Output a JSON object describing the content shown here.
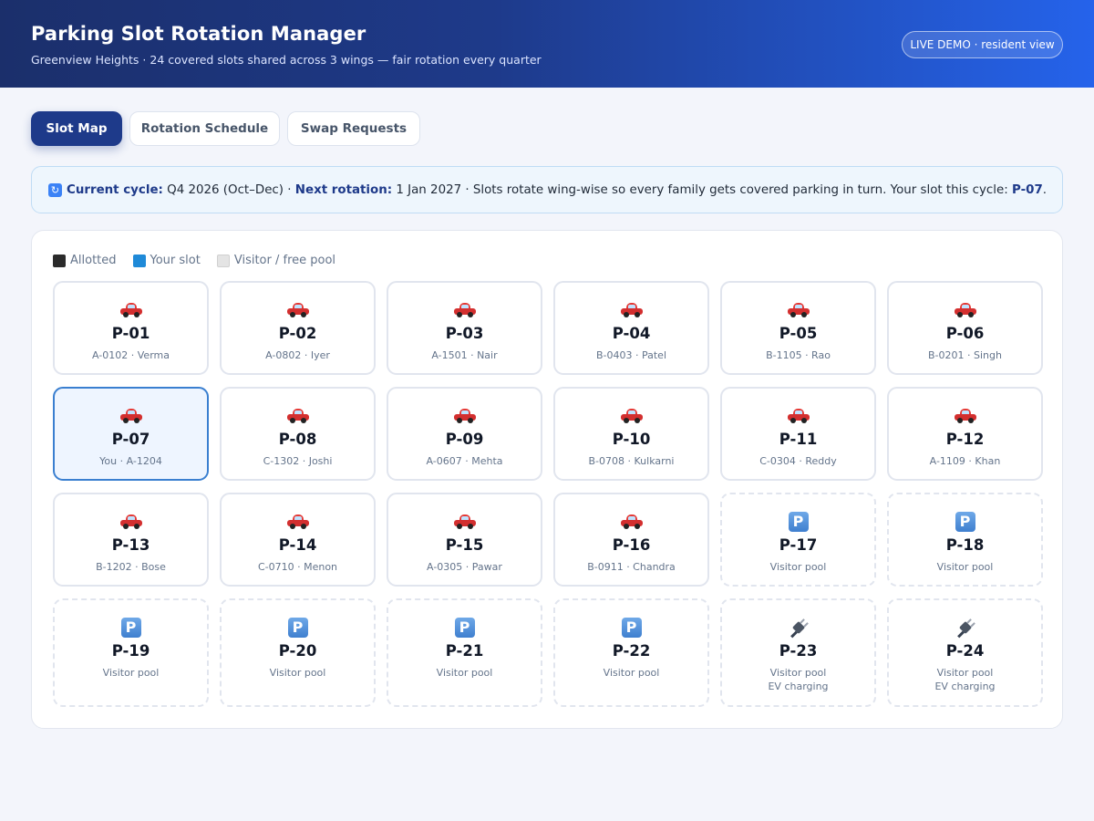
{
  "header": {
    "title": "Parking Slot Rotation Manager",
    "subtitle": "Greenview Heights · 24 covered slots shared across 3 wings — fair rotation every quarter",
    "badge": "LIVE DEMO · resident view"
  },
  "tabs": [
    {
      "label": "Slot Map",
      "active": true
    },
    {
      "label": "Rotation Schedule",
      "active": false
    },
    {
      "label": "Swap Requests",
      "active": false
    }
  ],
  "banner": {
    "current_cycle_label": "Current cycle:",
    "current_cycle_value": "Q4 2026 (Oct–Dec) ·",
    "next_rotation_label": "Next rotation:",
    "next_rotation_value": "1 Jan 2027 · Slots rotate wing-wise so every family gets covered parking in turn. Your slot this cycle:",
    "your_slot": "P-07",
    "end": "."
  },
  "legend": {
    "allotted": "Allotted",
    "yours": "Your slot",
    "free": "Visitor / free pool"
  },
  "slots": [
    {
      "code": "P-01",
      "occupant": "A-0102 · Verma",
      "icon": "car-icon",
      "status": "allotted"
    },
    {
      "code": "P-02",
      "occupant": "A-0802 · Iyer",
      "icon": "car-icon",
      "status": "allotted"
    },
    {
      "code": "P-03",
      "occupant": "A-1501 · Nair",
      "icon": "car-icon",
      "status": "allotted"
    },
    {
      "code": "P-04",
      "occupant": "B-0403 · Patel",
      "icon": "car-icon",
      "status": "allotted"
    },
    {
      "code": "P-05",
      "occupant": "B-1105 · Rao",
      "icon": "car-icon",
      "status": "allotted"
    },
    {
      "code": "P-06",
      "occupant": "B-0201 · Singh",
      "icon": "car-icon",
      "status": "allotted"
    },
    {
      "code": "P-07",
      "occupant": "You · A-1204",
      "icon": "car-icon",
      "status": "mine"
    },
    {
      "code": "P-08",
      "occupant": "C-1302 · Joshi",
      "icon": "car-icon",
      "status": "allotted"
    },
    {
      "code": "P-09",
      "occupant": "A-0607 · Mehta",
      "icon": "car-icon",
      "status": "allotted"
    },
    {
      "code": "P-10",
      "occupant": "B-0708 · Kulkarni",
      "icon": "car-icon",
      "status": "allotted"
    },
    {
      "code": "P-11",
      "occupant": "C-0304 · Reddy",
      "icon": "car-icon",
      "status": "allotted"
    },
    {
      "code": "P-12",
      "occupant": "A-1109 · Khan",
      "icon": "car-icon",
      "status": "allotted"
    },
    {
      "code": "P-13",
      "occupant": "B-1202 · Bose",
      "icon": "car-icon",
      "status": "allotted"
    },
    {
      "code": "P-14",
      "occupant": "C-0710 · Menon",
      "icon": "car-icon",
      "status": "allotted"
    },
    {
      "code": "P-15",
      "occupant": "A-0305 · Pawar",
      "icon": "car-icon",
      "status": "allotted"
    },
    {
      "code": "P-16",
      "occupant": "B-0911 · Chandra",
      "icon": "car-icon",
      "status": "allotted"
    },
    {
      "code": "P-17",
      "occupant": "Visitor pool",
      "icon": "parking-icon",
      "status": "pool"
    },
    {
      "code": "P-18",
      "occupant": "Visitor pool",
      "icon": "parking-icon",
      "status": "pool"
    },
    {
      "code": "P-19",
      "occupant": "Visitor pool",
      "icon": "parking-icon",
      "status": "pool"
    },
    {
      "code": "P-20",
      "occupant": "Visitor pool",
      "icon": "parking-icon",
      "status": "pool"
    },
    {
      "code": "P-21",
      "occupant": "Visitor pool",
      "icon": "parking-icon",
      "status": "pool"
    },
    {
      "code": "P-22",
      "occupant": "Visitor pool",
      "icon": "parking-icon",
      "status": "pool"
    },
    {
      "code": "P-23",
      "occupant": "Visitor pool",
      "extra": "EV charging",
      "icon": "ev-plug-icon",
      "status": "pool"
    },
    {
      "code": "P-24",
      "occupant": "Visitor pool",
      "extra": "EV charging",
      "icon": "ev-plug-icon",
      "status": "pool"
    }
  ],
  "colors": {
    "header_start": "#1b2f6b",
    "header_end": "#2563eb",
    "accent": "#1e3a8a",
    "your_slot_border": "#3a7fd0",
    "banner_bg": "#eef6fd"
  }
}
